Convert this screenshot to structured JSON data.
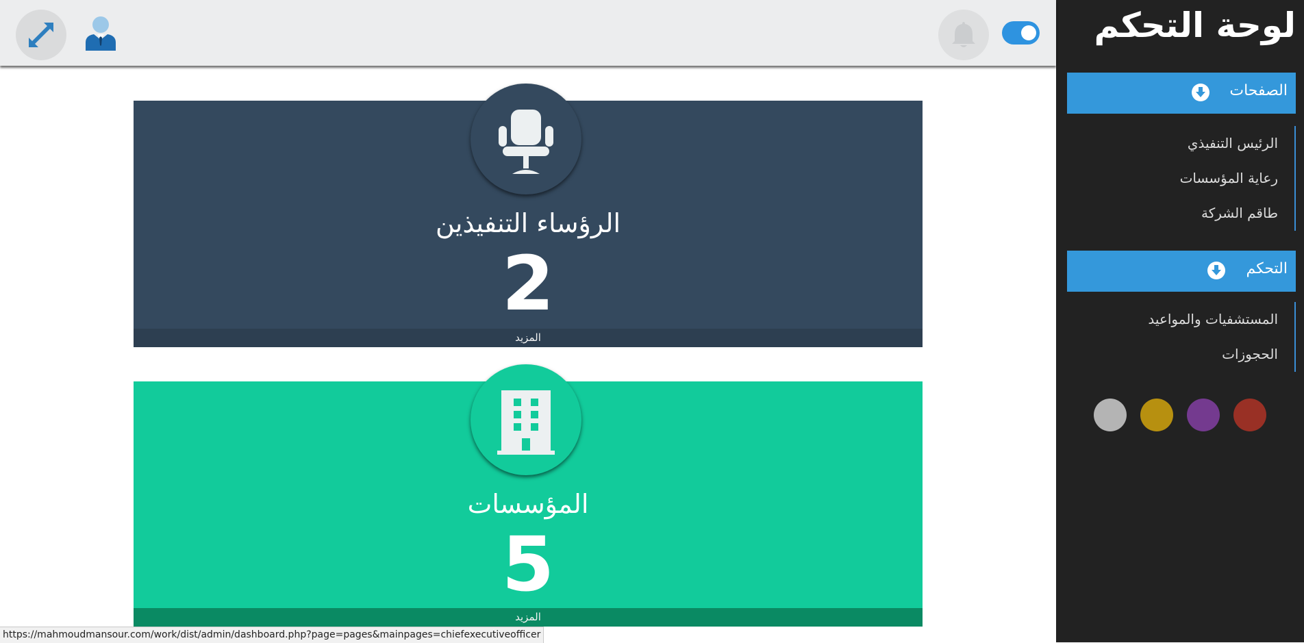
{
  "sidebar": {
    "title": "لوحة التحكم",
    "sections": [
      {
        "header": "الصفحات",
        "items": [
          "الرئيس التنفيذي",
          "رعاية المؤسسات",
          "طاقم الشركة"
        ]
      },
      {
        "header": "التحكم",
        "items": [
          "المستشفيات والمواعيد",
          "الحجوزات"
        ]
      }
    ],
    "theme_swatches": [
      "#b4b4b4",
      "#b79010",
      "#743a8f",
      "#993025"
    ]
  },
  "topbar": {
    "toggle_state": "on",
    "accent_color": "#2e93e0"
  },
  "cards": [
    {
      "title": "الرؤساء التنفيذين",
      "count": "2",
      "more_label": "المزيد",
      "icon": "office-chair-icon",
      "color": "#34495e"
    },
    {
      "title": "المؤسسات",
      "count": "5",
      "more_label": "المزيد",
      "icon": "building-icon",
      "color": "#12cb9b"
    }
  ],
  "statusbar": {
    "url": "https://mahmoudmansour.com/work/dist/admin/dashboard.php?page=pages&mainpages=chiefexecutiveofficer"
  }
}
